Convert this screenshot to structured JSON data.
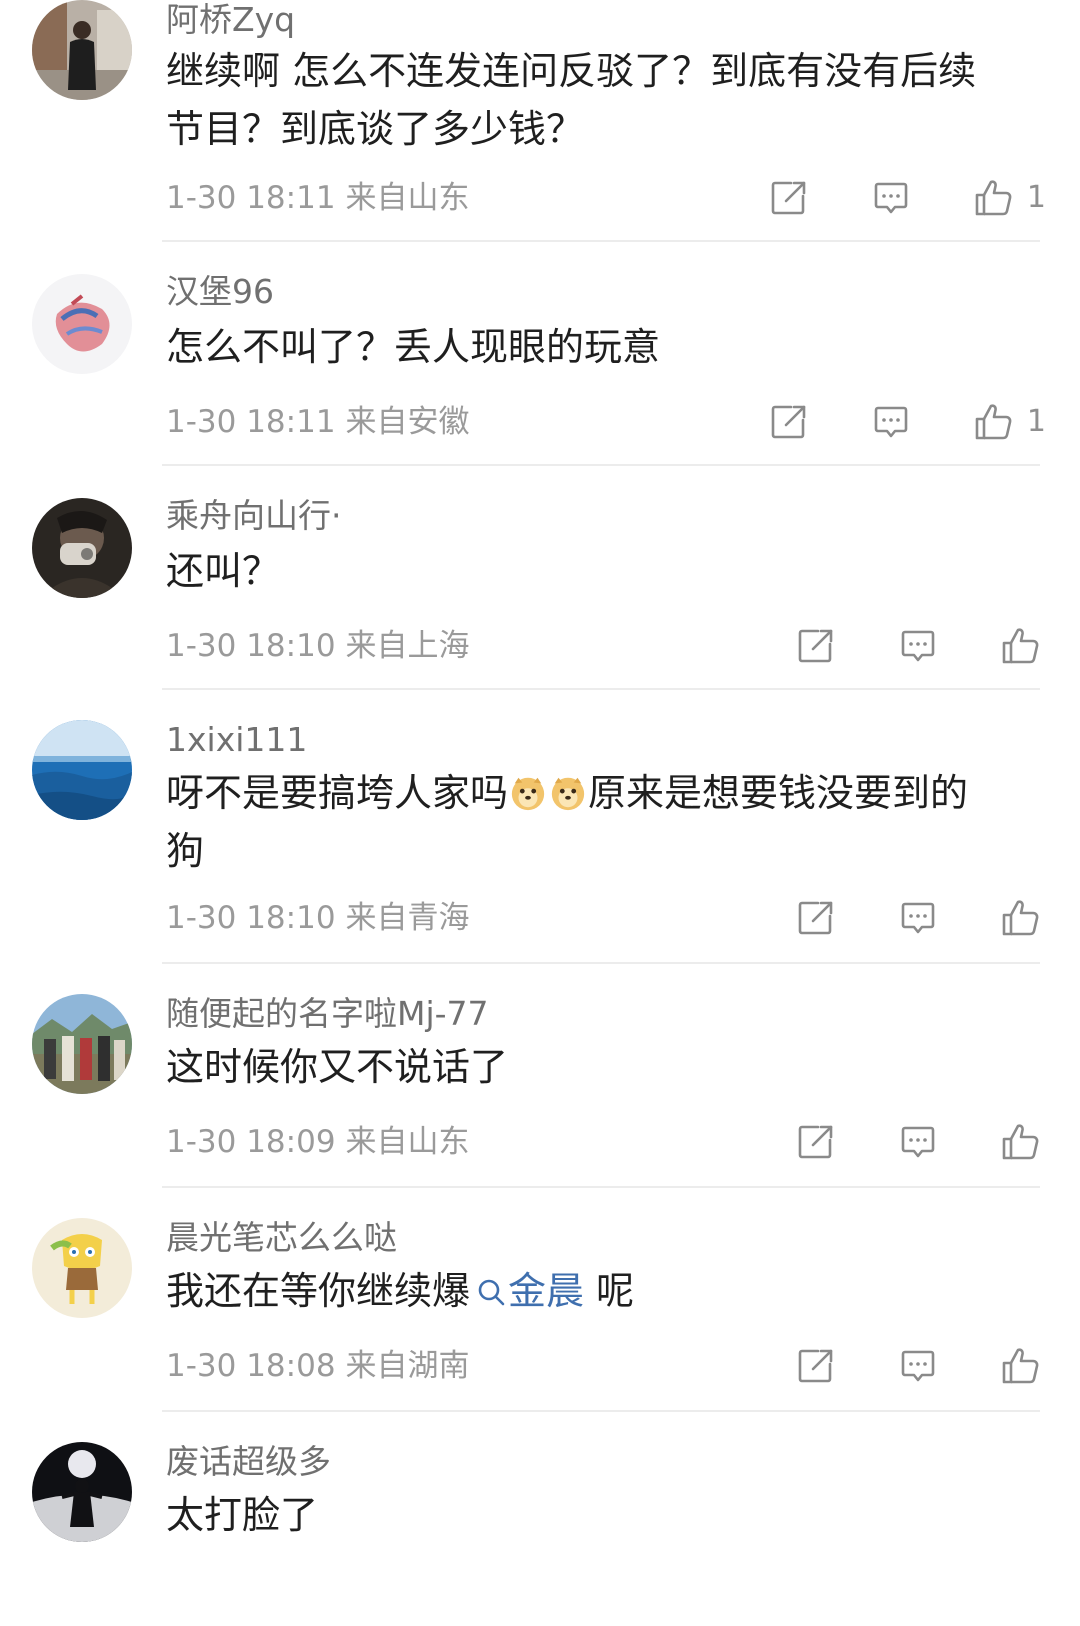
{
  "comments": [
    {
      "username": "阿桥Zyq",
      "text": "继续啊 怎么不连发连问反驳了？到底有没有后续节目？到底谈了多少钱？",
      "time": "1-30 18:11",
      "location": "来自山东",
      "likes": "1",
      "avatar": "photo-person-street"
    },
    {
      "username": "汉堡96",
      "text": "怎么不叫了？丢人现眼的玩意",
      "time": "1-30 18:11",
      "location": "来自安徽",
      "likes": "1",
      "avatar": "anatomical-heart-illustration"
    },
    {
      "username": "乘舟向山行·",
      "text": "还叫？",
      "time": "1-30 18:10",
      "location": "来自上海",
      "likes": "",
      "avatar": "photo-masked-person"
    },
    {
      "username": "1xixi111",
      "text_before_emoji": "呀不是要搞垮人家吗",
      "text_after_emoji": "原来是想要钱没要到的狗",
      "emoji": "doge-emoji",
      "time": "1-30 18:10",
      "location": "来自青海",
      "likes": "",
      "avatar": "photo-ocean"
    },
    {
      "username": "随便起的名字啦Mj-77",
      "text": "这时候你又不说话了",
      "time": "1-30 18:09",
      "location": "来自山东",
      "likes": "",
      "avatar": "photo-group-outdoors"
    },
    {
      "username": "晨光笔芯么么哒",
      "text_before_mention": "我还在等你继续爆",
      "mention": "金晨",
      "text_after_mention": " 呢",
      "time": "1-30 18:08",
      "location": "来自湖南",
      "likes": "",
      "avatar": "cartoon-sponge-character"
    },
    {
      "username": "废话超级多",
      "text": "太打脸了",
      "avatar": "photo-silhouette-moon"
    }
  ],
  "colors": {
    "username": "#707070",
    "text": "#1f1f1f",
    "meta": "#9a9a9a",
    "mention": "#3f6fae",
    "icon": "#8a8a8a",
    "divider": "#ececec"
  },
  "icons": [
    "share-icon",
    "reply-icon",
    "like-icon",
    "search-icon"
  ]
}
